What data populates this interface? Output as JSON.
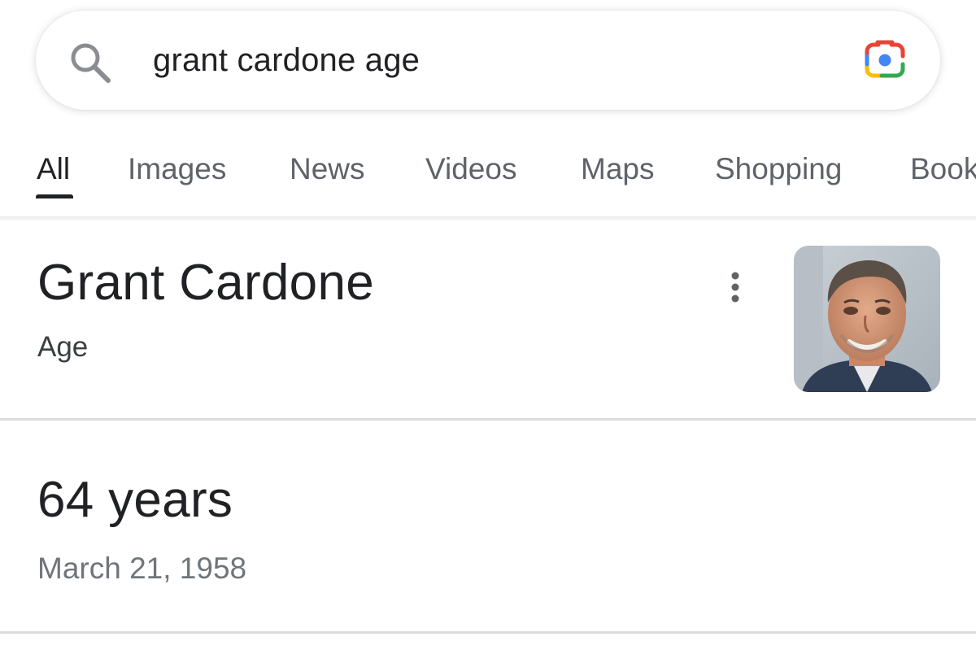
{
  "search": {
    "query": "grant cardone age",
    "icon": "search-icon",
    "lens_icon": "google-lens-icon"
  },
  "tabs": [
    {
      "label": "All",
      "active": true
    },
    {
      "label": "Images",
      "active": false
    },
    {
      "label": "News",
      "active": false
    },
    {
      "label": "Videos",
      "active": false
    },
    {
      "label": "Maps",
      "active": false
    },
    {
      "label": "Shopping",
      "active": false
    },
    {
      "label": "Books",
      "active": false
    }
  ],
  "knowledge_panel": {
    "title": "Grant Cardone",
    "subtitle": "Age",
    "more_icon": "more-vert-icon",
    "answer": "64 years",
    "date": "March 21, 1958"
  },
  "colors": {
    "text_primary": "#202124",
    "text_secondary": "#5f6368",
    "lens_blue": "#4285F4",
    "lens_red": "#EA4335",
    "lens_yellow": "#FBBC04",
    "lens_green": "#34A853"
  }
}
